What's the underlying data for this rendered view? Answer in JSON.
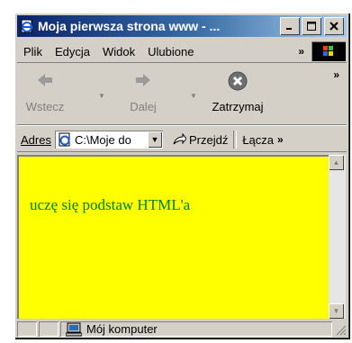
{
  "window": {
    "title": "Moja pierwsza strona www - ...",
    "title_bar_color": "#0a246a"
  },
  "menu": {
    "items": [
      {
        "label": "Plik",
        "underline": "P"
      },
      {
        "label": "Edycja",
        "underline": "E"
      },
      {
        "label": "Widok",
        "underline": "W"
      },
      {
        "label": "Ulubione",
        "underline": "U"
      }
    ],
    "more": "»"
  },
  "toolbar": {
    "back": "Wstecz",
    "forward": "Dalej",
    "stop": "Zatrzymaj",
    "more": "»"
  },
  "address": {
    "label": "Adres",
    "value": "C:\\Moje do",
    "go": "Przejdź",
    "links": "Łącza",
    "more": "»"
  },
  "page": {
    "text": "uczę się podstaw HTML'a",
    "background": "#ffff00",
    "text_color": "#008000"
  },
  "status": {
    "zone": "Mój komputer"
  }
}
